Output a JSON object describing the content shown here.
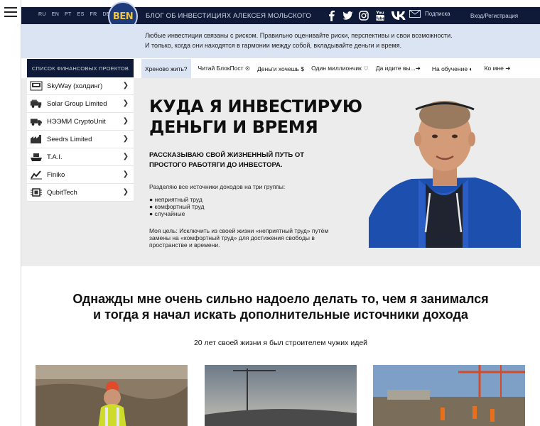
{
  "topbar": {
    "languages": [
      "RU",
      "EN",
      "PT",
      "ES",
      "FR",
      "DE"
    ],
    "logo_text": "BEN",
    "site_title": "БЛОГ ОБ ИНВЕСТИЦИЯХ АЛЕКСЕЯ МОЛЬСКОГО",
    "social_icons": [
      "facebook-icon",
      "twitter-icon",
      "instagram-icon",
      "youtube-icon",
      "vk-icon"
    ],
    "subscribe_label": "Подписка",
    "login_label": "Вход/Регистрация"
  },
  "tagline": {
    "line1": "Любые инвестиции связаны с риском. Правильно оценивайте риски, перспективы и свои возможности.",
    "line2": "И только, когда они находятся в гармонии между собой, вкладывайте деньги и время."
  },
  "sidebar": {
    "title": "СПИСОК ФИНАНСОВЫХ ПРОЕКТОВ",
    "items": [
      {
        "label": "SkyWay (холдинг)",
        "icon": "train-icon"
      },
      {
        "label": "Solar Group Limited",
        "icon": "solar-truck-icon"
      },
      {
        "label": "НЭЭМИ CryptoUnit",
        "icon": "truck-icon"
      },
      {
        "label": "Seedrs Limited",
        "icon": "factory-icon"
      },
      {
        "label": "T.A.I.",
        "icon": "ship-icon"
      },
      {
        "label": "Finiko",
        "icon": "chart-icon"
      },
      {
        "label": "QubitTech",
        "icon": "chip-icon"
      }
    ]
  },
  "tabs": [
    {
      "label": "Хреново жить?",
      "active": true
    },
    {
      "label": "Читай БлокПост ⊙",
      "active": false
    },
    {
      "label": "Деньги хочешь $",
      "active": false
    },
    {
      "label": "Один миллиончик ♡",
      "active": false
    },
    {
      "label": "Да идите вы...➜",
      "active": false
    },
    {
      "label": "На обучение ◐",
      "active": false
    },
    {
      "label": "Ко мне ➜",
      "active": false
    }
  ],
  "hero": {
    "title_line1": "КУДА Я ИНВЕСТИРУЮ",
    "title_line2": "ДЕНЬГИ И ВРЕМЯ",
    "subtitle_line1": "РАССКАЗЫВАЮ СВОЙ ЖИЗНЕННЫЙ ПУТЬ ОТ",
    "subtitle_line2": "ПРОСТОГО РАБОТЯГИ ДО ИНВЕСТОРА.",
    "intro": "Разделяю все источники доходов на три группы:",
    "list": [
      "● неприятный труд",
      "● комфортный труд",
      "● случайные"
    ],
    "goal_line1": "Моя цель: Исключить из своей жизни «неприятный труд» путём",
    "goal_line2": "замены на «комфортный труд» для достижения свободы в",
    "goal_line3": "пространстве и времени."
  },
  "story": {
    "title_line1": "Однажды мне очень сильно надоело делать то, чем я занимался",
    "title_line2": "и тогда я начал искать дополнительные источники дохода",
    "subtitle": "20 лет своей жизни я был строителем чужих идей"
  },
  "colors": {
    "topbar_bg": "#0e1a37",
    "tagline_bg": "#dbe4f3",
    "hero_bg": "#ececec",
    "logo_accent": "#f2c641"
  }
}
